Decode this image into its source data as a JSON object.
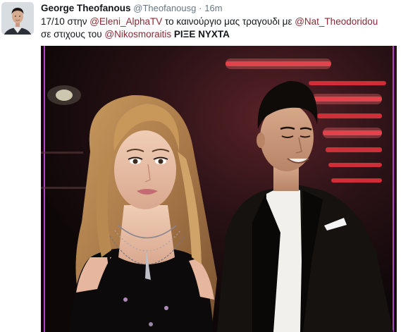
{
  "author": {
    "name": "George Theofanous",
    "handle": "@Theofanousg",
    "separator": "·",
    "time": "16m"
  },
  "tweet": {
    "line1": {
      "prefix": "17/10 στην ",
      "mention1": "@Eleni_AlphaTV",
      "middle": " το καινούργιο μας τραγουδι με ",
      "mention2": "@Nat_Theodoridou"
    },
    "line2": {
      "prefix": "σε στιχους του ",
      "mention3": "@Nikosmoraitis",
      "space": " ",
      "song_title": "ΡΙΞΕ ΝΥΧΤΑ"
    }
  },
  "colors": {
    "mention": "#8a2a35",
    "frame_border": "#b044c8",
    "background_dark": "#1a0f12"
  },
  "icons": {
    "avatar": "user-avatar-photo",
    "media": "photo-two-singers"
  }
}
